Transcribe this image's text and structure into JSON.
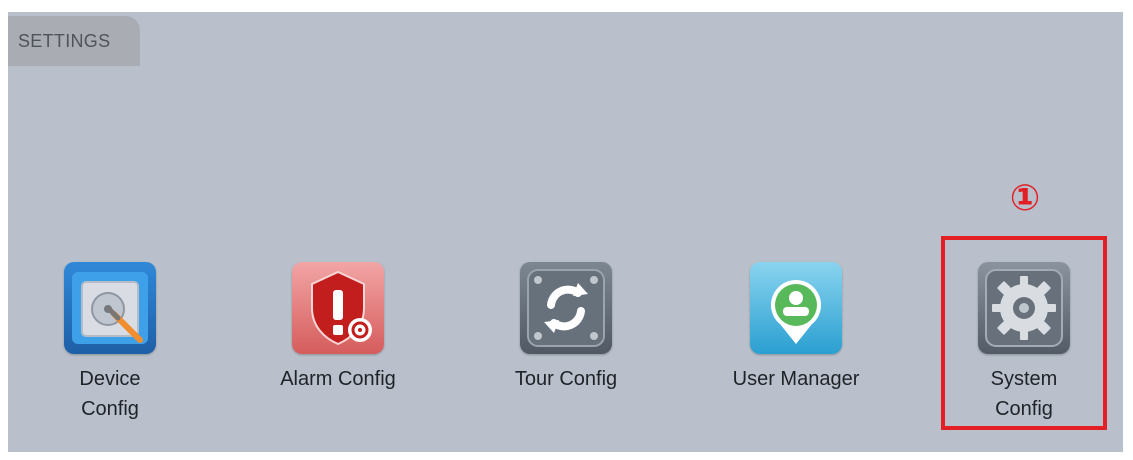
{
  "tab": {
    "label": "SETTINGS"
  },
  "items": [
    {
      "label": "Device\nConfig",
      "icon": "device-config-icon"
    },
    {
      "label": "Alarm Config",
      "icon": "alarm-config-icon"
    },
    {
      "label": "Tour Config",
      "icon": "tour-config-icon"
    },
    {
      "label": "User Manager",
      "icon": "user-manager-icon"
    },
    {
      "label": "System\nConfig",
      "icon": "system-config-icon"
    }
  ],
  "annotation": {
    "marker": "①"
  },
  "colors": {
    "panel": "#b9c0cb",
    "tab": "#a9adb3",
    "highlight": "#e11f25"
  }
}
